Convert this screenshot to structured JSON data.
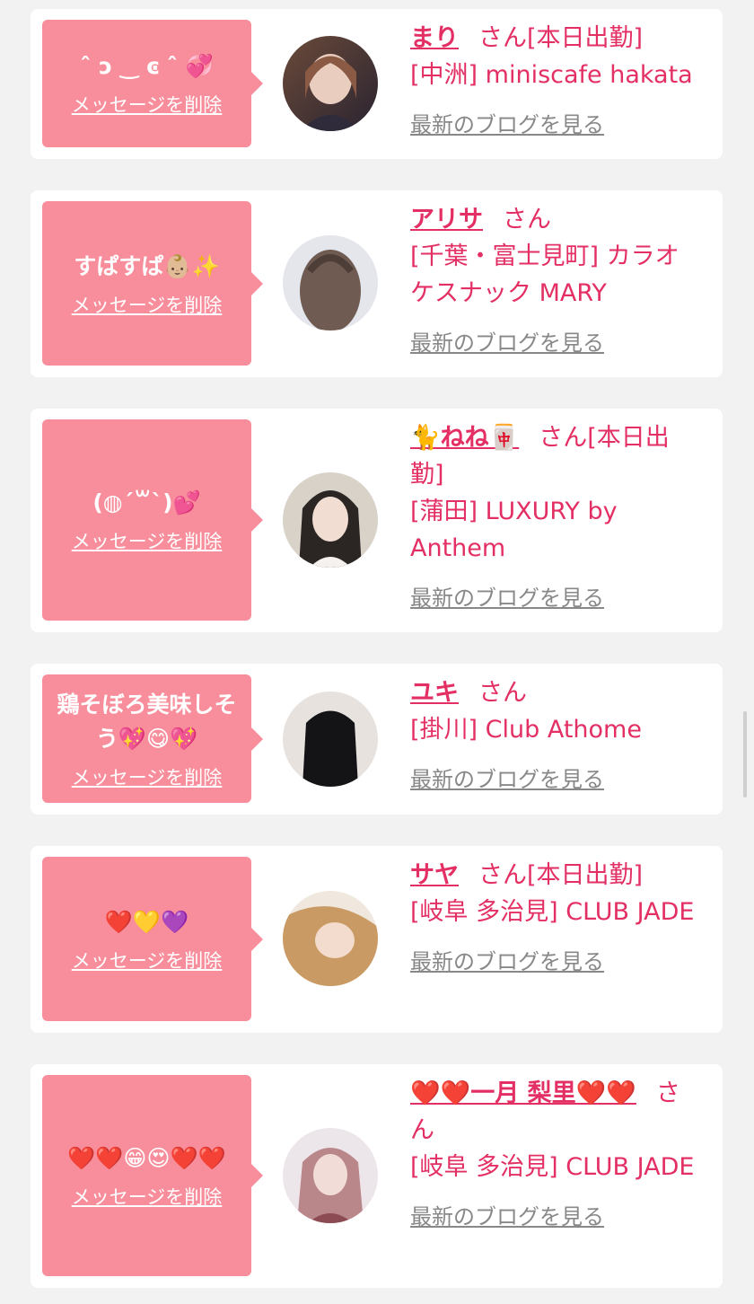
{
  "delete_label": "メッセージを削除",
  "san_label": "さん",
  "blog_label": "最新のブログを見る",
  "items": [
    {
      "message": "ˆ ͻ ‿ ͼ ˆ 💞",
      "name": "まり",
      "suffix": "[本日出勤]",
      "shop": "[中洲] miniscafe hakata"
    },
    {
      "message": "すぱすぱ👶🏼✨",
      "name": "アリサ",
      "suffix": "",
      "shop": "[千葉・富士見町] カラオケスナック MARY"
    },
    {
      "message": "(◍´꒳`)💕",
      "name": "🐈ねね🀄️",
      "suffix": "[本日出勤]",
      "shop": "[蒲田] LUXURY by Anthem"
    },
    {
      "message": "鶏そぼろ美味しそう💖😋💖",
      "name": "ユキ",
      "suffix": "",
      "shop": "[掛川] Club Athome"
    },
    {
      "message": "❤️💛💜",
      "name": "サヤ",
      "suffix": "[本日出勤]",
      "shop": "[岐阜 多治見] CLUB JADE"
    },
    {
      "message": "❤️❤️😁😍❤️❤️",
      "name": "❤️❤️一月 梨里❤️❤️",
      "suffix": "",
      "shop": "[岐阜 多治見] CLUB JADE"
    }
  ]
}
